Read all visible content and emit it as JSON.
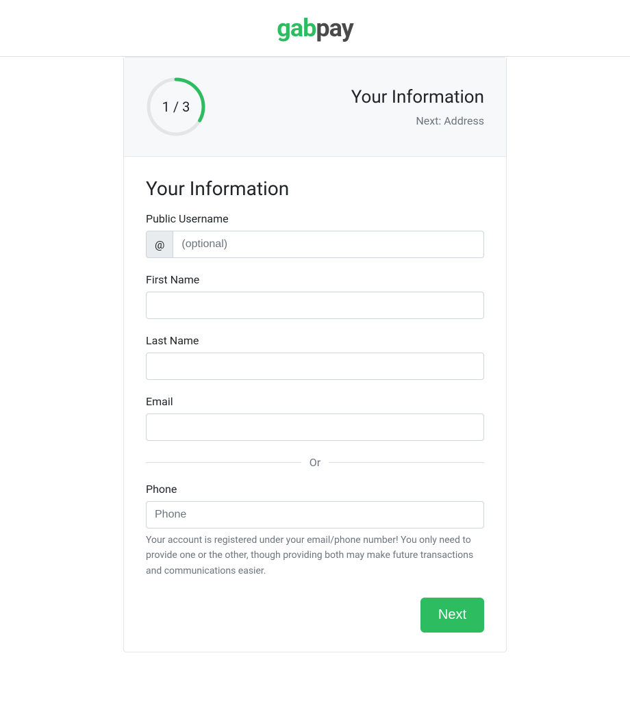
{
  "logo": {
    "part1": "gab",
    "part2": "pay"
  },
  "progress": {
    "label": "1 / 3",
    "current": 1,
    "total": 3,
    "title": "Your Information",
    "next_prefix": "Next: ",
    "next_label": "Address"
  },
  "form": {
    "heading": "Your Information",
    "username": {
      "label": "Public Username",
      "prefix": "@",
      "placeholder": "(optional)",
      "value": ""
    },
    "first_name": {
      "label": "First Name",
      "value": ""
    },
    "last_name": {
      "label": "Last Name",
      "value": ""
    },
    "email": {
      "label": "Email",
      "value": ""
    },
    "divider": "Or",
    "phone": {
      "label": "Phone",
      "placeholder": "Phone",
      "value": ""
    },
    "help_text": "Your account is registered under your email/phone number! You only need to provide one or the other, though providing both may make future transactions and communications easier.",
    "next_button": "Next"
  }
}
